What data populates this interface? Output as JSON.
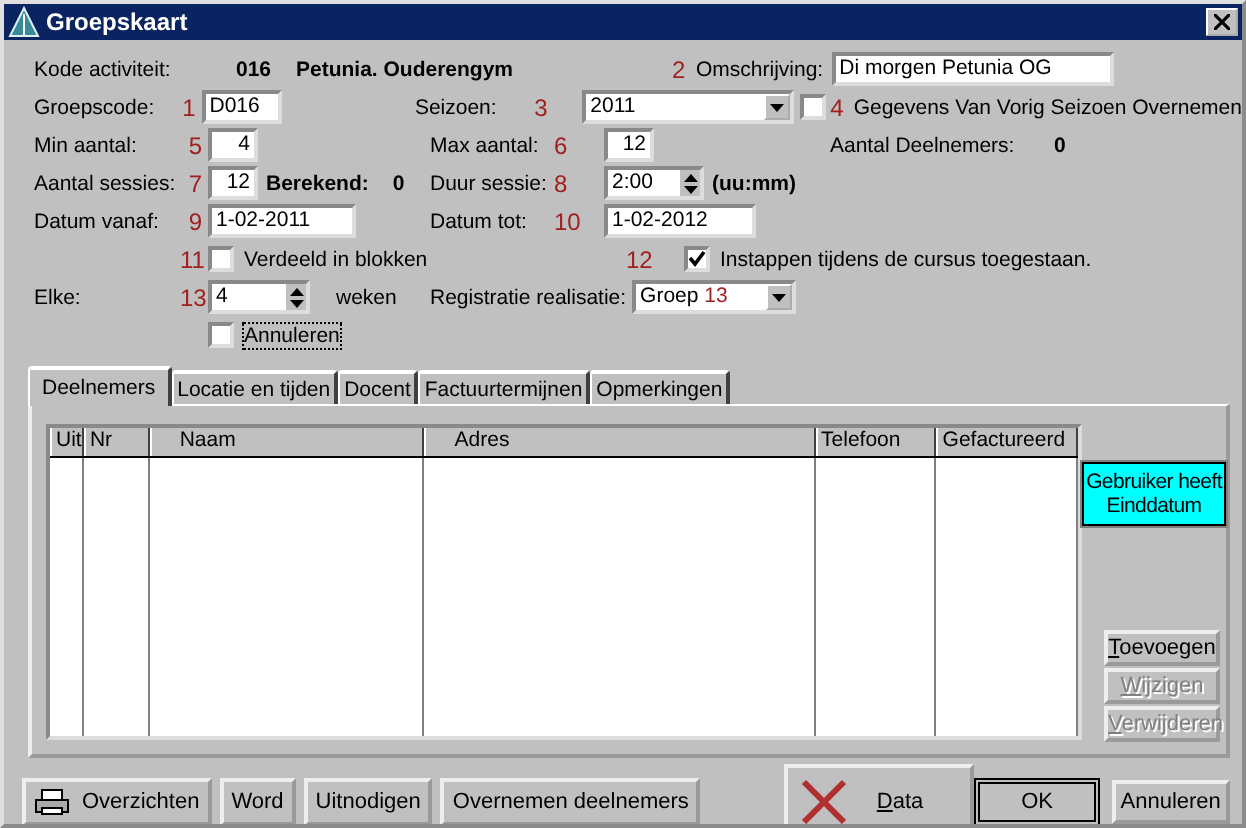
{
  "window": {
    "title": "Groepskaart"
  },
  "activity": {
    "label": "Kode activiteit:",
    "code": "016",
    "name": "Petunia. Ouderengym"
  },
  "description": {
    "marker": "2",
    "label": "Omschrijving:",
    "value": "Di morgen Petunia OG"
  },
  "group_code": {
    "marker": "1",
    "label": "Groepscode:",
    "value": "D016"
  },
  "season": {
    "marker": "3",
    "label": "Seizoen:",
    "value": "2011"
  },
  "copy_previous": {
    "marker": "4",
    "label": "Gegevens Van Vorig Seizoen Overnemen",
    "checked": false
  },
  "min_count": {
    "marker": "5",
    "label": "Min aantal:",
    "value": "4"
  },
  "max_count": {
    "marker": "6",
    "label": "Max aantal:",
    "value": "12"
  },
  "participants": {
    "label": "Aantal Deelnemers:",
    "value": "0"
  },
  "sessions": {
    "marker": "7",
    "label": "Aantal sessies:",
    "value": "12",
    "computed_label": "Berekend:",
    "computed_value": "0"
  },
  "duration": {
    "marker": "8",
    "label": "Duur sessie:",
    "value": "2:00",
    "unit": "(uu:mm)"
  },
  "date_from": {
    "marker": "9",
    "label": "Datum vanaf:",
    "value": "1-02-2011"
  },
  "date_to": {
    "marker": "10",
    "label": "Datum tot:",
    "value": "1-02-2012"
  },
  "blocks": {
    "marker": "11",
    "label": "Verdeeld in blokken",
    "checked": false
  },
  "join_during": {
    "marker": "12",
    "label": "Instappen tijdens de cursus toegestaan.",
    "checked": true
  },
  "every": {
    "marker": "13",
    "label": "Elke:",
    "value": "4",
    "unit": "weken"
  },
  "registration": {
    "label": "Registratie realisatie:",
    "value": "Groep",
    "marker": "13"
  },
  "cancel": {
    "label": "Annuleren",
    "checked": false
  },
  "tabs": [
    {
      "label": "Deelnemers",
      "selected": true
    },
    {
      "label": "Locatie en tijden",
      "selected": false
    },
    {
      "label": "Docent",
      "selected": false
    },
    {
      "label": "Factuurtermijnen",
      "selected": false
    },
    {
      "label": "Opmerkingen",
      "selected": false
    }
  ],
  "table": {
    "columns": [
      "Uit",
      "Nr",
      "Naam",
      "Adres",
      "Telefoon",
      "Gefactureerd"
    ]
  },
  "notice": "Gebruiker heeft Einddatum",
  "side_buttons": [
    {
      "label": "Toevoegen",
      "disabled": false
    },
    {
      "label": "Wijzigen",
      "disabled": true
    },
    {
      "label": "Verwijderen",
      "disabled": true
    }
  ],
  "bottom_buttons": [
    {
      "label": "Overzichten",
      "kind": "print"
    },
    {
      "label": "Word",
      "kind": "plain"
    },
    {
      "label": "Uitnodigen",
      "kind": "plain"
    },
    {
      "label": "Overnemen deelnemers",
      "kind": "plain"
    }
  ],
  "data_button": {
    "label": "Data"
  },
  "ok_button": {
    "label": "OK",
    "default": true
  },
  "cancel_button": {
    "label": "Annuleren",
    "default": false
  }
}
